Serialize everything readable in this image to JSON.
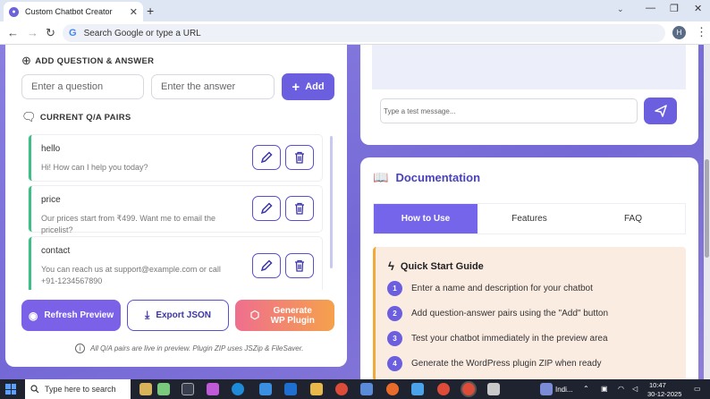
{
  "browser": {
    "tab_title": "Custom Chatbot Creator",
    "tab_close": "✕",
    "new_tab": "+",
    "omnibox_placeholder": "Search Google or type a URL",
    "profile_initial": "H"
  },
  "builder": {
    "add_section_title": "ADD QUESTION & ANSWER",
    "question_placeholder": "Enter a question",
    "answer_placeholder": "Enter the answer",
    "add_label": "Add",
    "pairs_section_title": "CURRENT Q/A PAIRS",
    "pairs": [
      {
        "question": "hello",
        "answer": "Hi! How can I help you today?"
      },
      {
        "question": "price",
        "answer": "Our prices start from ₹499. Want me to email the pricelist?"
      },
      {
        "question": "contact",
        "answer": "You can reach us at support@example.com or call +91-1234567890"
      }
    ],
    "refresh_label": "Refresh Preview",
    "export_label": "Export JSON",
    "generate_label": "Generate WP Plugin",
    "footnote": "All Q/A pairs are live in preview. Plugin ZIP uses JSZip & FileSaver."
  },
  "preview": {
    "test_placeholder": "Type a test message..."
  },
  "docs": {
    "title": "Documentation",
    "tabs": [
      "How to Use",
      "Features",
      "FAQ"
    ],
    "guide_title": "Quick Start Guide",
    "steps": [
      "Enter a name and description for your chatbot",
      "Add question-answer pairs using the \"Add\" button",
      "Test your chatbot immediately in the preview area",
      "Generate the WordPress plugin ZIP when ready"
    ]
  },
  "taskbar": {
    "search_placeholder": "Type here to search",
    "weather": "Indi...",
    "time": "10:47",
    "date": "30-12-2025"
  },
  "colors": {
    "accent": "#6b5fe0",
    "qa_border": "#3bbf87",
    "guide_border": "#f2a93b"
  }
}
